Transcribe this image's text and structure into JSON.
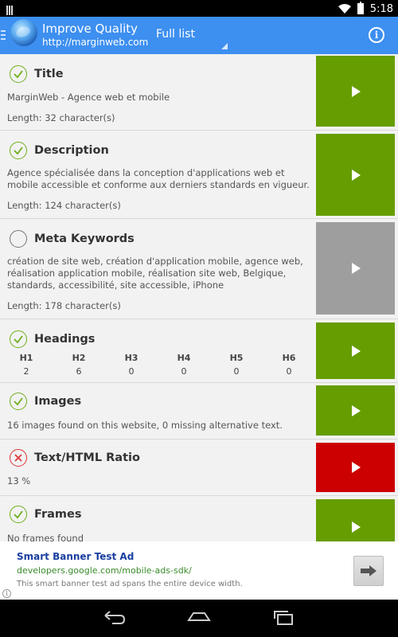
{
  "status_bar": {
    "time": "5:18"
  },
  "action_bar": {
    "title": "Improve Quality",
    "subtitle": "http://marginweb.com",
    "spinner_label": "Full list"
  },
  "items": [
    {
      "title": "Title",
      "status": "ok",
      "description": "MarginWeb - Agence web et mobile",
      "length": "Length:  32 character(s)",
      "button_color": "#669d00"
    },
    {
      "title": "Description",
      "status": "ok",
      "description": "Agence spécialisée dans la conception d'applications web et mobile accessible et conforme aux derniers standards en vigueur.",
      "length": "Length:  124 character(s)",
      "button_color": "#669d00"
    },
    {
      "title": "Meta Keywords",
      "status": "none",
      "description": "création de site web, création d'application mobile, agence web, réalisation application mobile, réalisation site web, Belgique, standards, accessibilité, site accessible, iPhone",
      "length": "Length:  178 character(s)",
      "button_color": "#9e9e9e"
    },
    {
      "title": "Headings",
      "status": "ok",
      "button_color": "#669d00",
      "headings": [
        {
          "label": "H1",
          "value": "2"
        },
        {
          "label": "H2",
          "value": "6"
        },
        {
          "label": "H3",
          "value": "0"
        },
        {
          "label": "H4",
          "value": "0"
        },
        {
          "label": "H5",
          "value": "0"
        },
        {
          "label": "H6",
          "value": "0"
        }
      ]
    },
    {
      "title": "Images",
      "status": "ok",
      "description": "16 images found on this website, 0 missing alternative text.",
      "button_color": "#669d00"
    },
    {
      "title": "Text/HTML Ratio",
      "status": "error",
      "description": "13 %",
      "button_color": "#cc0000"
    },
    {
      "title": "Frames",
      "status": "ok",
      "description": "No frames found",
      "button_color": "#669d00"
    }
  ],
  "ad": {
    "title": "Smart Banner Test Ad",
    "url": "developers.google.com/mobile-ads-sdk/",
    "description": "This smart banner test ad spans the entire device width."
  }
}
